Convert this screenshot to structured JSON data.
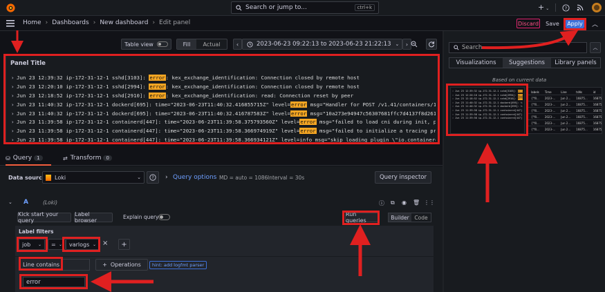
{
  "topbar": {
    "search_placeholder": "Search or jump to...",
    "shortcut": "ctrl+k",
    "plus_label": "+",
    "colors": {
      "bg": "#181b1f",
      "brand": "#f46800"
    }
  },
  "navbar": {
    "breadcrumbs": [
      "Home",
      "Dashboards",
      "New dashboard",
      "Edit panel"
    ],
    "discard_label": "Discard",
    "save_label": "Save",
    "apply_label": "Apply",
    "apply_color": "#3d71d9",
    "discard_color": "#e0226e"
  },
  "toolbar": {
    "table_view_label": "Table view",
    "fill_label": "Fill",
    "actual_label": "Actual",
    "time_range": "2023-06-23 09:22:13 to 2023-06-23 21:22:13"
  },
  "panel": {
    "title": "Panel Title",
    "logs": [
      {
        "prefix": "Jun 23 12:39:32 ip-172-31-12-1 sshd[3103]: ",
        "hl": "error",
        "suffix": ": kex_exchange_identification: Connection closed by remote host"
      },
      {
        "prefix": "Jun 23 12:20:10 ip-172-31-12-1 sshd[2994]: ",
        "hl": "error",
        "suffix": ": kex_exchange_identification: Connection closed by remote host"
      },
      {
        "prefix": "Jun 23 12:18:52 ip-172-31-12-1 sshd[2910]: ",
        "hl": "error",
        "suffix": ": kex_exchange_identification: read: Connection reset by peer"
      },
      {
        "prefix": "Jun 23 11:40:32 ip-172-31-12-1 dockerd[695]: time=\"2023-06-23T11:40:32.416855715Z\" level=",
        "hl": "error",
        "suffix": " msg=\"Handler for POST /v1.41/containers/10a273e"
      },
      {
        "prefix": "Jun 23 11:40:32 ip-172-31-12-1 dockerd[695]: time=\"2023-06-23T11:40:32.416787583Z\" level=",
        "hl": "error",
        "suffix": " msg=\"10a273e94947c56307681ffc7d4137f8d261da7fe0"
      },
      {
        "prefix": "Jun 23 11:39:58 ip-172-31-12-1 containerd[447]: time=\"2023-06-23T11:39:58.375793560Z\" level=",
        "hl": "error",
        "suffix": " msg=\"failed to load cni during init, please c"
      },
      {
        "prefix": "Jun 23 11:39:58 ip-172-31-12-1 containerd[447]: time=\"2023-06-23T11:39:58.366974919Z\" level=",
        "hl": "error",
        "suffix": " msg=\"failed to initialize a tracing processo"
      },
      {
        "prefix": "Jun 23 11:39:58 ip-172-31-12-1 containerd[447]: time=\"2023-06-23T11:39:58.366934121Z\" level=info msg=\"skip loading plugin \\\"io.containerd.trac",
        "hl": "",
        "suffix": ""
      }
    ]
  },
  "query_tabs": {
    "query_label": "Query",
    "query_count": "1",
    "transform_label": "Transform",
    "transform_count": "0"
  },
  "datasource": {
    "label": "Data source",
    "value": "Loki",
    "query_options_label": "Query options",
    "md_info": "MD = auto = 1086",
    "interval_info": "Interval = 30s",
    "query_inspector_label": "Query inspector"
  },
  "query_row": {
    "ref_id": "A",
    "ds_name": "(Loki)",
    "kick_start_label": "Kick start your query",
    "label_browser_label": "Label browser",
    "explain_label": "Explain query",
    "run_queries_label": "Run queries",
    "builder_label": "Builder",
    "code_label": "Code",
    "label_filters_title": "Label filters",
    "filter_key": "job",
    "filter_op": "=",
    "filter_value": "varlogs",
    "remove_label": "×",
    "add_label": "+",
    "line_contains_label": "Line contains",
    "operations_label": "Operations",
    "hint_label": "hint: add logfmt parser",
    "line_value": "error"
  },
  "right_panel": {
    "search_placeholder": "Search",
    "tabs": [
      "Visualizations",
      "Suggestions",
      "Library panels"
    ],
    "based_on": "Based on current data",
    "table_headers": [
      "labels",
      "Time",
      "Line",
      "tsNs",
      "id"
    ],
    "table_rows": [
      [
        "{\"fil...",
        "2023-...",
        "Jun 2...",
        "16875...",
        "16875..."
      ],
      [
        "{\"fil...",
        "2023-...",
        "Jun 2...",
        "16875...",
        "16875..."
      ],
      [
        "{\"fil...",
        "2023-...",
        "Jun 2...",
        "16875...",
        "16875..."
      ],
      [
        "{\"fil...",
        "2023-...",
        "Jun 2...",
        "16875...",
        "16875..."
      ],
      [
        "{\"fil...",
        "2023-...",
        "Jun 2...",
        "16875...",
        "16875..."
      ],
      [
        "{\"fil...",
        "2023-...",
        "Jun 2...",
        "16875...",
        "16875..."
      ]
    ]
  }
}
